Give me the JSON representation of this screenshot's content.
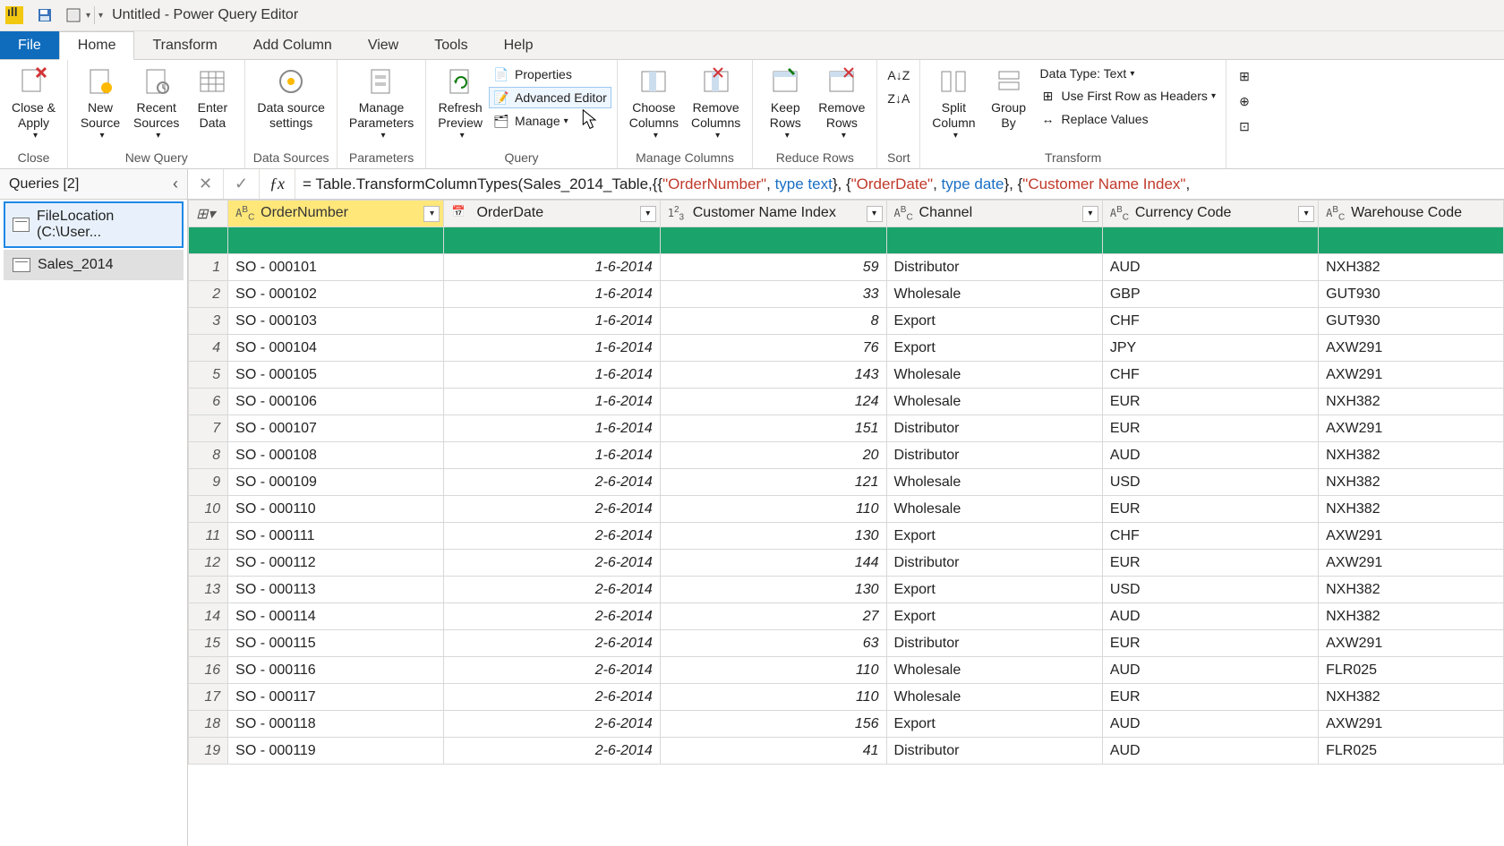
{
  "titlebar": {
    "title": "Untitled - Power Query Editor"
  },
  "menu": {
    "file": "File",
    "tabs": [
      "Home",
      "Transform",
      "Add Column",
      "View",
      "Tools",
      "Help"
    ],
    "active": "Home"
  },
  "ribbon": {
    "close_apply": "Close &\nApply",
    "close_group": "Close",
    "new_source": "New\nSource",
    "recent_sources": "Recent\nSources",
    "enter_data": "Enter\nData",
    "new_query_group": "New Query",
    "data_source_settings": "Data source\nsettings",
    "data_sources_group": "Data Sources",
    "manage_parameters": "Manage\nParameters",
    "parameters_group": "Parameters",
    "refresh_preview": "Refresh\nPreview",
    "properties": "Properties",
    "advanced_editor": "Advanced Editor",
    "manage": "Manage",
    "query_group": "Query",
    "choose_columns": "Choose\nColumns",
    "remove_columns": "Remove\nColumns",
    "manage_columns_group": "Manage Columns",
    "keep_rows": "Keep\nRows",
    "remove_rows": "Remove\nRows",
    "reduce_rows_group": "Reduce Rows",
    "sort_group": "Sort",
    "split_column": "Split\nColumn",
    "group_by": "Group\nBy",
    "data_type": "Data Type: Text",
    "first_row_headers": "Use First Row as Headers",
    "replace_values": "Replace Values",
    "transform_group": "Transform"
  },
  "formula": {
    "prefix": "= Table.TransformColumnTypes(Sales_2014_Table,{{",
    "s1": "\"OrderNumber\"",
    "t1": ", type text}, {",
    "s2": "\"OrderDate\"",
    "t2": ", type date}, {",
    "s3": "\"Customer Name Index\"",
    "tail": ","
  },
  "queries": {
    "header": "Queries [2]",
    "items": [
      {
        "label": "FileLocation (C:\\User...",
        "selected": true
      },
      {
        "label": "Sales_2014",
        "active": true
      }
    ]
  },
  "columns": [
    {
      "name": "OrderNumber",
      "type": "ABC",
      "selected": true
    },
    {
      "name": "OrderDate",
      "type": "date"
    },
    {
      "name": "Customer Name Index",
      "type": "123"
    },
    {
      "name": "Channel",
      "type": "ABC"
    },
    {
      "name": "Currency Code",
      "type": "ABC"
    },
    {
      "name": "Warehouse Code",
      "type": "ABC"
    }
  ],
  "rows": [
    {
      "n": 1,
      "OrderNumber": "SO - 000101",
      "OrderDate": "1-6-2014",
      "CustomerNameIndex": 59,
      "Channel": "Distributor",
      "CurrencyCode": "AUD",
      "WarehouseCode": "NXH382"
    },
    {
      "n": 2,
      "OrderNumber": "SO - 000102",
      "OrderDate": "1-6-2014",
      "CustomerNameIndex": 33,
      "Channel": "Wholesale",
      "CurrencyCode": "GBP",
      "WarehouseCode": "GUT930"
    },
    {
      "n": 3,
      "OrderNumber": "SO - 000103",
      "OrderDate": "1-6-2014",
      "CustomerNameIndex": 8,
      "Channel": "Export",
      "CurrencyCode": "CHF",
      "WarehouseCode": "GUT930"
    },
    {
      "n": 4,
      "OrderNumber": "SO - 000104",
      "OrderDate": "1-6-2014",
      "CustomerNameIndex": 76,
      "Channel": "Export",
      "CurrencyCode": "JPY",
      "WarehouseCode": "AXW291"
    },
    {
      "n": 5,
      "OrderNumber": "SO - 000105",
      "OrderDate": "1-6-2014",
      "CustomerNameIndex": 143,
      "Channel": "Wholesale",
      "CurrencyCode": "CHF",
      "WarehouseCode": "AXW291"
    },
    {
      "n": 6,
      "OrderNumber": "SO - 000106",
      "OrderDate": "1-6-2014",
      "CustomerNameIndex": 124,
      "Channel": "Wholesale",
      "CurrencyCode": "EUR",
      "WarehouseCode": "NXH382"
    },
    {
      "n": 7,
      "OrderNumber": "SO - 000107",
      "OrderDate": "1-6-2014",
      "CustomerNameIndex": 151,
      "Channel": "Distributor",
      "CurrencyCode": "EUR",
      "WarehouseCode": "AXW291"
    },
    {
      "n": 8,
      "OrderNumber": "SO - 000108",
      "OrderDate": "1-6-2014",
      "CustomerNameIndex": 20,
      "Channel": "Distributor",
      "CurrencyCode": "AUD",
      "WarehouseCode": "NXH382"
    },
    {
      "n": 9,
      "OrderNumber": "SO - 000109",
      "OrderDate": "2-6-2014",
      "CustomerNameIndex": 121,
      "Channel": "Wholesale",
      "CurrencyCode": "USD",
      "WarehouseCode": "NXH382"
    },
    {
      "n": 10,
      "OrderNumber": "SO - 000110",
      "OrderDate": "2-6-2014",
      "CustomerNameIndex": 110,
      "Channel": "Wholesale",
      "CurrencyCode": "EUR",
      "WarehouseCode": "NXH382"
    },
    {
      "n": 11,
      "OrderNumber": "SO - 000111",
      "OrderDate": "2-6-2014",
      "CustomerNameIndex": 130,
      "Channel": "Export",
      "CurrencyCode": "CHF",
      "WarehouseCode": "AXW291"
    },
    {
      "n": 12,
      "OrderNumber": "SO - 000112",
      "OrderDate": "2-6-2014",
      "CustomerNameIndex": 144,
      "Channel": "Distributor",
      "CurrencyCode": "EUR",
      "WarehouseCode": "AXW291"
    },
    {
      "n": 13,
      "OrderNumber": "SO - 000113",
      "OrderDate": "2-6-2014",
      "CustomerNameIndex": 130,
      "Channel": "Export",
      "CurrencyCode": "USD",
      "WarehouseCode": "NXH382"
    },
    {
      "n": 14,
      "OrderNumber": "SO - 000114",
      "OrderDate": "2-6-2014",
      "CustomerNameIndex": 27,
      "Channel": "Export",
      "CurrencyCode": "AUD",
      "WarehouseCode": "NXH382"
    },
    {
      "n": 15,
      "OrderNumber": "SO - 000115",
      "OrderDate": "2-6-2014",
      "CustomerNameIndex": 63,
      "Channel": "Distributor",
      "CurrencyCode": "EUR",
      "WarehouseCode": "AXW291"
    },
    {
      "n": 16,
      "OrderNumber": "SO - 000116",
      "OrderDate": "2-6-2014",
      "CustomerNameIndex": 110,
      "Channel": "Wholesale",
      "CurrencyCode": "AUD",
      "WarehouseCode": "FLR025"
    },
    {
      "n": 17,
      "OrderNumber": "SO - 000117",
      "OrderDate": "2-6-2014",
      "CustomerNameIndex": 110,
      "Channel": "Wholesale",
      "CurrencyCode": "EUR",
      "WarehouseCode": "NXH382"
    },
    {
      "n": 18,
      "OrderNumber": "SO - 000118",
      "OrderDate": "2-6-2014",
      "CustomerNameIndex": 156,
      "Channel": "Export",
      "CurrencyCode": "AUD",
      "WarehouseCode": "AXW291"
    },
    {
      "n": 19,
      "OrderNumber": "SO - 000119",
      "OrderDate": "2-6-2014",
      "CustomerNameIndex": 41,
      "Channel": "Distributor",
      "CurrencyCode": "AUD",
      "WarehouseCode": "FLR025"
    }
  ]
}
